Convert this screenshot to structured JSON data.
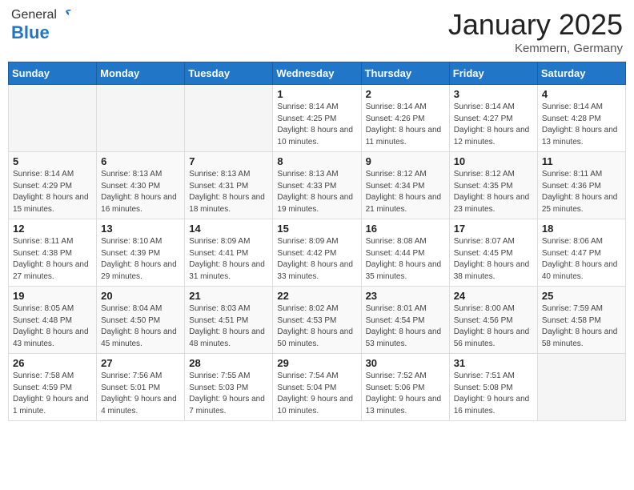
{
  "header": {
    "logo_general": "General",
    "logo_blue": "Blue",
    "month_title": "January 2025",
    "location": "Kemmern, Germany"
  },
  "calendar": {
    "days_of_week": [
      "Sunday",
      "Monday",
      "Tuesday",
      "Wednesday",
      "Thursday",
      "Friday",
      "Saturday"
    ],
    "weeks": [
      [
        {
          "day": "",
          "info": ""
        },
        {
          "day": "",
          "info": ""
        },
        {
          "day": "",
          "info": ""
        },
        {
          "day": "1",
          "info": "Sunrise: 8:14 AM\nSunset: 4:25 PM\nDaylight: 8 hours\nand 10 minutes."
        },
        {
          "day": "2",
          "info": "Sunrise: 8:14 AM\nSunset: 4:26 PM\nDaylight: 8 hours\nand 11 minutes."
        },
        {
          "day": "3",
          "info": "Sunrise: 8:14 AM\nSunset: 4:27 PM\nDaylight: 8 hours\nand 12 minutes."
        },
        {
          "day": "4",
          "info": "Sunrise: 8:14 AM\nSunset: 4:28 PM\nDaylight: 8 hours\nand 13 minutes."
        }
      ],
      [
        {
          "day": "5",
          "info": "Sunrise: 8:14 AM\nSunset: 4:29 PM\nDaylight: 8 hours\nand 15 minutes."
        },
        {
          "day": "6",
          "info": "Sunrise: 8:13 AM\nSunset: 4:30 PM\nDaylight: 8 hours\nand 16 minutes."
        },
        {
          "day": "7",
          "info": "Sunrise: 8:13 AM\nSunset: 4:31 PM\nDaylight: 8 hours\nand 18 minutes."
        },
        {
          "day": "8",
          "info": "Sunrise: 8:13 AM\nSunset: 4:33 PM\nDaylight: 8 hours\nand 19 minutes."
        },
        {
          "day": "9",
          "info": "Sunrise: 8:12 AM\nSunset: 4:34 PM\nDaylight: 8 hours\nand 21 minutes."
        },
        {
          "day": "10",
          "info": "Sunrise: 8:12 AM\nSunset: 4:35 PM\nDaylight: 8 hours\nand 23 minutes."
        },
        {
          "day": "11",
          "info": "Sunrise: 8:11 AM\nSunset: 4:36 PM\nDaylight: 8 hours\nand 25 minutes."
        }
      ],
      [
        {
          "day": "12",
          "info": "Sunrise: 8:11 AM\nSunset: 4:38 PM\nDaylight: 8 hours\nand 27 minutes."
        },
        {
          "day": "13",
          "info": "Sunrise: 8:10 AM\nSunset: 4:39 PM\nDaylight: 8 hours\nand 29 minutes."
        },
        {
          "day": "14",
          "info": "Sunrise: 8:09 AM\nSunset: 4:41 PM\nDaylight: 8 hours\nand 31 minutes."
        },
        {
          "day": "15",
          "info": "Sunrise: 8:09 AM\nSunset: 4:42 PM\nDaylight: 8 hours\nand 33 minutes."
        },
        {
          "day": "16",
          "info": "Sunrise: 8:08 AM\nSunset: 4:44 PM\nDaylight: 8 hours\nand 35 minutes."
        },
        {
          "day": "17",
          "info": "Sunrise: 8:07 AM\nSunset: 4:45 PM\nDaylight: 8 hours\nand 38 minutes."
        },
        {
          "day": "18",
          "info": "Sunrise: 8:06 AM\nSunset: 4:47 PM\nDaylight: 8 hours\nand 40 minutes."
        }
      ],
      [
        {
          "day": "19",
          "info": "Sunrise: 8:05 AM\nSunset: 4:48 PM\nDaylight: 8 hours\nand 43 minutes."
        },
        {
          "day": "20",
          "info": "Sunrise: 8:04 AM\nSunset: 4:50 PM\nDaylight: 8 hours\nand 45 minutes."
        },
        {
          "day": "21",
          "info": "Sunrise: 8:03 AM\nSunset: 4:51 PM\nDaylight: 8 hours\nand 48 minutes."
        },
        {
          "day": "22",
          "info": "Sunrise: 8:02 AM\nSunset: 4:53 PM\nDaylight: 8 hours\nand 50 minutes."
        },
        {
          "day": "23",
          "info": "Sunrise: 8:01 AM\nSunset: 4:54 PM\nDaylight: 8 hours\nand 53 minutes."
        },
        {
          "day": "24",
          "info": "Sunrise: 8:00 AM\nSunset: 4:56 PM\nDaylight: 8 hours\nand 56 minutes."
        },
        {
          "day": "25",
          "info": "Sunrise: 7:59 AM\nSunset: 4:58 PM\nDaylight: 8 hours\nand 58 minutes."
        }
      ],
      [
        {
          "day": "26",
          "info": "Sunrise: 7:58 AM\nSunset: 4:59 PM\nDaylight: 9 hours\nand 1 minute."
        },
        {
          "day": "27",
          "info": "Sunrise: 7:56 AM\nSunset: 5:01 PM\nDaylight: 9 hours\nand 4 minutes."
        },
        {
          "day": "28",
          "info": "Sunrise: 7:55 AM\nSunset: 5:03 PM\nDaylight: 9 hours\nand 7 minutes."
        },
        {
          "day": "29",
          "info": "Sunrise: 7:54 AM\nSunset: 5:04 PM\nDaylight: 9 hours\nand 10 minutes."
        },
        {
          "day": "30",
          "info": "Sunrise: 7:52 AM\nSunset: 5:06 PM\nDaylight: 9 hours\nand 13 minutes."
        },
        {
          "day": "31",
          "info": "Sunrise: 7:51 AM\nSunset: 5:08 PM\nDaylight: 9 hours\nand 16 minutes."
        },
        {
          "day": "",
          "info": ""
        }
      ]
    ]
  }
}
